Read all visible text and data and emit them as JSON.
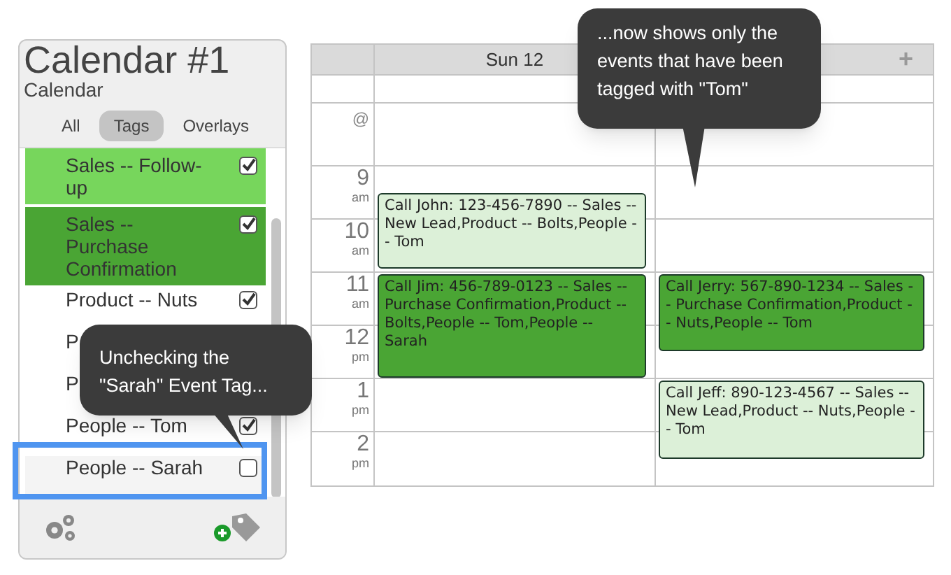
{
  "sidebar": {
    "title": "Calendar #1",
    "subtitle": "Calendar",
    "tabs": [
      {
        "label": "All",
        "selected": false
      },
      {
        "label": "Tags",
        "selected": true
      },
      {
        "label": "Overlays",
        "selected": false
      }
    ],
    "tags": [
      {
        "label": "Sales -- Follow-up",
        "checked": true,
        "color": "#77d65c"
      },
      {
        "label": "Sales -- Purchase Confirmation",
        "checked": true,
        "color": "#4aa534"
      },
      {
        "label": "Product -- Nuts",
        "checked": true
      },
      {
        "label": "P"
      },
      {
        "label": "P"
      },
      {
        "label": "People -- Tom",
        "checked": true
      },
      {
        "label": "People -- Sarah",
        "checked": false,
        "highlighted": true
      }
    ]
  },
  "calendar": {
    "columns": [
      {
        "label": "Sun 12"
      },
      {
        "label": "+"
      }
    ],
    "all_day_label": "@",
    "hours": [
      {
        "hour": "9",
        "period": "am"
      },
      {
        "hour": "10",
        "period": "am"
      },
      {
        "hour": "11",
        "period": "am"
      },
      {
        "hour": "12",
        "period": "pm"
      },
      {
        "hour": "1",
        "period": "pm"
      },
      {
        "hour": "2",
        "period": "pm"
      }
    ],
    "events": [
      {
        "text": "Call John: 123-456-7890 -- Sales -- New Lead,Product -- Bolts,People -- Tom",
        "color": "#dcf0d8"
      },
      {
        "text": "Call Jim: 456-789-0123 -- Sales -- Purchase Confirmation,Product -- Bolts,People -- Tom,People -- Sarah",
        "color": "#4aa534"
      },
      {
        "text": "Call Jerry: 567-890-1234 -- Sales -- Purchase Confirmation,Product -- Nuts,People -- Tom",
        "color": "#4aa534"
      },
      {
        "text": "Call Jeff: 890-123-4567 -- Sales -- New Lead,Product -- Nuts,People -- Tom",
        "color": "#dcf0d8"
      }
    ]
  },
  "callouts": [
    {
      "text": "...now shows only the events that have been tagged with \"Tom\""
    },
    {
      "text": "Unchecking the \"Sarah\" Event Tag..."
    }
  ]
}
